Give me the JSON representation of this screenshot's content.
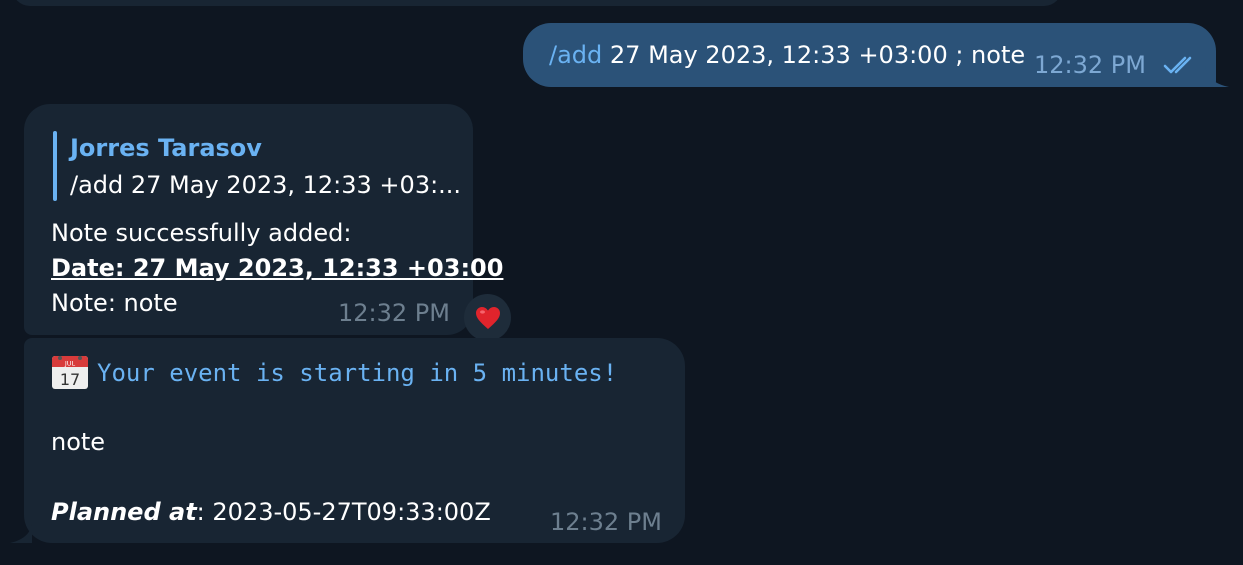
{
  "outgoing": {
    "command": "/add",
    "text": " 27 May 2023, 12:33 +03:00 ; note",
    "time": "12:32 PM",
    "status_icon": "double-check-icon"
  },
  "incoming_1": {
    "reply": {
      "name": "Jorres Tarasov",
      "snippet": "/add 27 May 2023, 12:33 +03:..."
    },
    "lines": [
      "Note successfully added:",
      "Date: 27 May 2023, 12:33 +03:00",
      "Note: note"
    ],
    "time": "12:32 PM",
    "reaction": "❤️"
  },
  "incoming_2": {
    "icon": "calendar-icon",
    "calendar_month": "JUL",
    "calendar_day": "17",
    "headline": "Your event is starting in 5 minutes!",
    "note": "note",
    "planned_label": "Planned at",
    "planned_value": ": 2023-05-27T09:33:00Z",
    "time": "12:32 PM"
  },
  "colors": {
    "background": "#0e1621",
    "incoming_bubble": "#182533",
    "outgoing_bubble": "#2b5278",
    "accent": "#6ab2f2"
  }
}
